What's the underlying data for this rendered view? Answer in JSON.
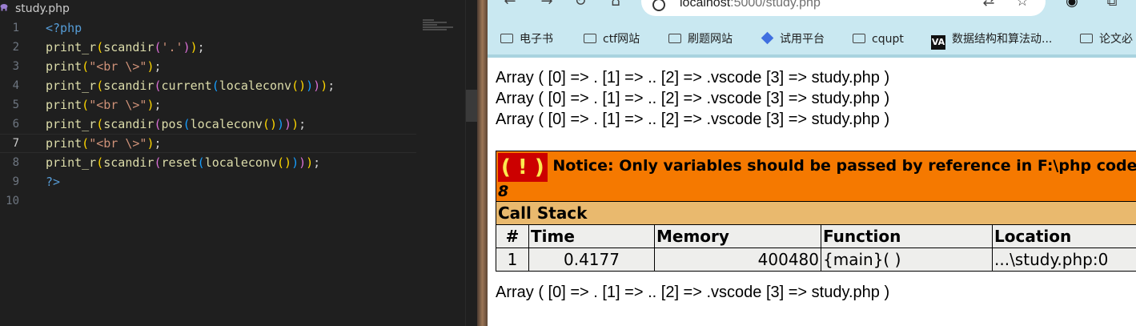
{
  "editor": {
    "tab_label": "study.php",
    "lines": [
      {
        "n": "1",
        "tokens": [
          {
            "t": "<?php",
            "c": "tag"
          }
        ]
      },
      {
        "n": "2",
        "tokens": [
          {
            "t": "print_r",
            "c": "fn"
          },
          {
            "t": "(",
            "c": "b1"
          },
          {
            "t": "scandir",
            "c": "fn"
          },
          {
            "t": "(",
            "c": "b2"
          },
          {
            "t": "'.'",
            "c": "str"
          },
          {
            "t": ")",
            "c": "b2"
          },
          {
            "t": ")",
            "c": "b1"
          },
          {
            "t": ";",
            "c": "p"
          }
        ]
      },
      {
        "n": "3",
        "tokens": [
          {
            "t": "print",
            "c": "fn"
          },
          {
            "t": "(",
            "c": "b1"
          },
          {
            "t": "\"<br \\>\"",
            "c": "str"
          },
          {
            "t": ")",
            "c": "b1"
          },
          {
            "t": ";",
            "c": "p"
          }
        ]
      },
      {
        "n": "4",
        "tokens": [
          {
            "t": "print_r",
            "c": "fn"
          },
          {
            "t": "(",
            "c": "b1"
          },
          {
            "t": "scandir",
            "c": "fn"
          },
          {
            "t": "(",
            "c": "b2"
          },
          {
            "t": "current",
            "c": "fn"
          },
          {
            "t": "(",
            "c": "b3"
          },
          {
            "t": "localeconv",
            "c": "fn"
          },
          {
            "t": "()",
            "c": "b1"
          },
          {
            "t": ")",
            "c": "b3"
          },
          {
            "t": ")",
            "c": "b2"
          },
          {
            "t": ")",
            "c": "b1"
          },
          {
            "t": ";",
            "c": "p"
          }
        ]
      },
      {
        "n": "5",
        "tokens": [
          {
            "t": "print",
            "c": "fn"
          },
          {
            "t": "(",
            "c": "b1"
          },
          {
            "t": "\"<br \\>\"",
            "c": "str"
          },
          {
            "t": ")",
            "c": "b1"
          },
          {
            "t": ";",
            "c": "p"
          }
        ]
      },
      {
        "n": "6",
        "tokens": [
          {
            "t": "print_r",
            "c": "fn"
          },
          {
            "t": "(",
            "c": "b1"
          },
          {
            "t": "scandir",
            "c": "fn"
          },
          {
            "t": "(",
            "c": "b2"
          },
          {
            "t": "pos",
            "c": "fn"
          },
          {
            "t": "(",
            "c": "b3"
          },
          {
            "t": "localeconv",
            "c": "fn"
          },
          {
            "t": "()",
            "c": "b1"
          },
          {
            "t": ")",
            "c": "b3"
          },
          {
            "t": ")",
            "c": "b2"
          },
          {
            "t": ")",
            "c": "b1"
          },
          {
            "t": ";",
            "c": "p"
          }
        ]
      },
      {
        "n": "7",
        "current": true,
        "tokens": [
          {
            "t": "print",
            "c": "fn"
          },
          {
            "t": "(",
            "c": "b1"
          },
          {
            "t": "\"<br \\>\"",
            "c": "str"
          },
          {
            "t": ")",
            "c": "b1"
          },
          {
            "t": ";",
            "c": "p"
          }
        ]
      },
      {
        "n": "8",
        "tokens": [
          {
            "t": "print_r",
            "c": "fn"
          },
          {
            "t": "(",
            "c": "b1"
          },
          {
            "t": "scandir",
            "c": "fn"
          },
          {
            "t": "(",
            "c": "b2"
          },
          {
            "t": "reset",
            "c": "fn"
          },
          {
            "t": "(",
            "c": "b3"
          },
          {
            "t": "localeconv",
            "c": "fn"
          },
          {
            "t": "()",
            "c": "b1"
          },
          {
            "t": ")",
            "c": "b3"
          },
          {
            "t": ")",
            "c": "b2"
          },
          {
            "t": ")",
            "c": "b1"
          },
          {
            "t": ";",
            "c": "p"
          }
        ]
      },
      {
        "n": "9",
        "tokens": [
          {
            "t": "?>",
            "c": "tag"
          }
        ]
      },
      {
        "n": "10",
        "tokens": []
      }
    ]
  },
  "browser": {
    "url_host": "localhost",
    "url_rest": ":5000/study.php",
    "bookmarks": [
      {
        "label": "电子书",
        "icon": "folder-icon"
      },
      {
        "label": "ctf网站",
        "icon": "folder-icon"
      },
      {
        "label": "刷题网站",
        "icon": "folder-icon"
      },
      {
        "label": "试用平台",
        "icon": "diamond-icon"
      },
      {
        "label": "cqupt",
        "icon": "folder-icon"
      },
      {
        "label": "数据结构和算法动...",
        "icon": "va-logo-icon"
      },
      {
        "label": "论文必",
        "icon": "folder-icon"
      }
    ]
  },
  "page": {
    "output_lines": [
      "Array ( [0] => . [1] => .. [2] => .vscode [3] => study.php )",
      "Array ( [0] => . [1] => .. [2] => .vscode [3] => study.php )",
      "Array ( [0] => . [1] => .. [2] => .vscode [3] => study.php )"
    ],
    "notice": {
      "icon_text": "( ! )",
      "message": "Notice: Only variables should be passed by reference in F:\\php code\\study",
      "line": "8"
    },
    "call_stack": {
      "title": "Call Stack",
      "headers": [
        "#",
        "Time",
        "Memory",
        "Function",
        "Location"
      ],
      "row": [
        "1",
        "0.4177",
        "400480",
        "{main}( )",
        "...\\study.php:0"
      ]
    },
    "last_line": "Array ( [0] => . [1] => .. [2] => .vscode [3] => study.php )"
  },
  "colors": {
    "notice_bg": "#f57900",
    "notice_icon_bg": "#cc0000",
    "callstack_bg": "#e9b96e",
    "table_bg": "#eeeeec",
    "browser_chrome": "#c9e8f1"
  }
}
